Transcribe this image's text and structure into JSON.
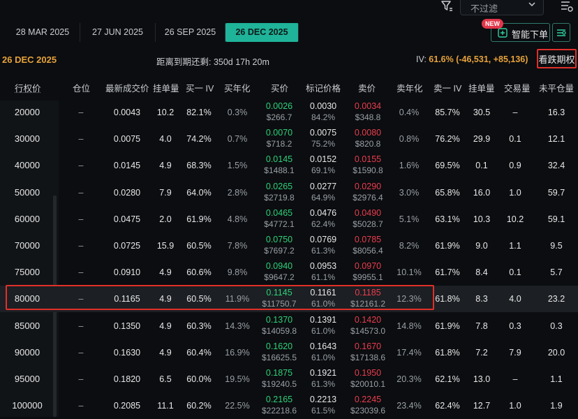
{
  "toolbar": {
    "filter_value": "不过滤",
    "filter_icon": "funnel-icon",
    "settings_icon": "list-settings-icon"
  },
  "tabs": [
    {
      "label": "28 MAR 2025",
      "active": false
    },
    {
      "label": "27 JUN 2025",
      "active": false
    },
    {
      "label": "26 SEP 2025",
      "active": false
    },
    {
      "label": "26 DEC 2025",
      "active": true
    }
  ],
  "smart_order": {
    "label": "智能下单",
    "badge": "NEW"
  },
  "info": {
    "date": "26 DEC 2025",
    "expiry": "距离到期还剩: 350d 17h 20m",
    "iv_label": "IV: ",
    "iv_value": "61.6% (-46,531, +85,136)",
    "put_label": "看跌期权"
  },
  "headers": [
    "行权价",
    "仓位",
    "最新成交价",
    "挂单量",
    "买一 IV",
    "买年化",
    "买价",
    "标记价格",
    "卖价",
    "卖年化",
    "卖一 IV",
    "挂单量",
    "交易量",
    "未平仓量"
  ],
  "rows": [
    {
      "strike": "20000",
      "pos": "–",
      "last": "0.0043",
      "bid_size": "10.2",
      "bid_iv": "82.1%",
      "bid_ann": "0.3%",
      "bid": "0.0026",
      "bid_usd": "$266.7",
      "mark": "0.0030",
      "mark_iv": "84.2%",
      "ask": "0.0034",
      "ask_usd": "$348.8",
      "ask_ann": "0.4%",
      "ask_iv": "85.7%",
      "ask_size": "30.5",
      "volume": "–",
      "oi": "16.3"
    },
    {
      "strike": "30000",
      "pos": "–",
      "last": "0.0075",
      "bid_size": "4.0",
      "bid_iv": "74.2%",
      "bid_ann": "0.7%",
      "bid": "0.0070",
      "bid_usd": "$718.2",
      "mark": "0.0075",
      "mark_iv": "75.2%",
      "ask": "0.0080",
      "ask_usd": "$820.8",
      "ask_ann": "0.8%",
      "ask_iv": "76.2%",
      "ask_size": "29.9",
      "volume": "0.1",
      "oi": "12.1"
    },
    {
      "strike": "40000",
      "pos": "–",
      "last": "0.0145",
      "bid_size": "4.9",
      "bid_iv": "68.3%",
      "bid_ann": "1.5%",
      "bid": "0.0145",
      "bid_usd": "$1488.1",
      "mark": "0.0152",
      "mark_iv": "69.1%",
      "ask": "0.0155",
      "ask_usd": "$1590.8",
      "ask_ann": "1.6%",
      "ask_iv": "69.5%",
      "ask_size": "0.1",
      "volume": "0.9",
      "oi": "32.4"
    },
    {
      "strike": "50000",
      "pos": "–",
      "last": "0.0280",
      "bid_size": "7.9",
      "bid_iv": "64.0%",
      "bid_ann": "2.8%",
      "bid": "0.0265",
      "bid_usd": "$2719.8",
      "mark": "0.0277",
      "mark_iv": "64.9%",
      "ask": "0.0290",
      "ask_usd": "$2976.4",
      "ask_ann": "3.0%",
      "ask_iv": "65.8%",
      "ask_size": "16.0",
      "volume": "1.0",
      "oi": "59.7"
    },
    {
      "strike": "60000",
      "pos": "–",
      "last": "0.0475",
      "bid_size": "2.0",
      "bid_iv": "61.9%",
      "bid_ann": "4.8%",
      "bid": "0.0465",
      "bid_usd": "$4772.1",
      "mark": "0.0476",
      "mark_iv": "62.4%",
      "ask": "0.0490",
      "ask_usd": "$5028.7",
      "ask_ann": "5.1%",
      "ask_iv": "63.1%",
      "ask_size": "10.3",
      "volume": "10.2",
      "oi": "59.1"
    },
    {
      "strike": "70000",
      "pos": "–",
      "last": "0.0725",
      "bid_size": "15.9",
      "bid_iv": "60.5%",
      "bid_ann": "7.8%",
      "bid": "0.0750",
      "bid_usd": "$7697.2",
      "mark": "0.0769",
      "mark_iv": "61.3%",
      "ask": "0.0785",
      "ask_usd": "$8056.4",
      "ask_ann": "8.2%",
      "ask_iv": "61.9%",
      "ask_size": "9.0",
      "volume": "1.1",
      "oi": "9.5"
    },
    {
      "strike": "75000",
      "pos": "–",
      "last": "0.0910",
      "bid_size": "4.9",
      "bid_iv": "60.6%",
      "bid_ann": "9.8%",
      "bid": "0.0940",
      "bid_usd": "$9647.2",
      "mark": "0.0953",
      "mark_iv": "61.1%",
      "ask": "0.0970",
      "ask_usd": "$9955.1",
      "ask_ann": "10.1%",
      "ask_iv": "61.7%",
      "ask_size": "8.4",
      "volume": "0.1",
      "oi": "5.7"
    },
    {
      "strike": "80000",
      "pos": "–",
      "last": "0.1165",
      "bid_size": "4.9",
      "bid_iv": "60.5%",
      "bid_ann": "11.9%",
      "bid": "0.1145",
      "bid_usd": "$11750.7",
      "mark": "0.1161",
      "mark_iv": "61.0%",
      "ask": "0.1185",
      "ask_usd": "$12161.2",
      "ask_ann": "12.3%",
      "ask_iv": "61.8%",
      "ask_size": "8.3",
      "volume": "4.0",
      "oi": "23.2"
    },
    {
      "strike": "85000",
      "pos": "–",
      "last": "0.1350",
      "bid_size": "4.9",
      "bid_iv": "60.3%",
      "bid_ann": "14.3%",
      "bid": "0.1370",
      "bid_usd": "$14059.8",
      "mark": "0.1391",
      "mark_iv": "61.0%",
      "ask": "0.1420",
      "ask_usd": "$14573.0",
      "ask_ann": "14.8%",
      "ask_iv": "61.9%",
      "ask_size": "7.8",
      "volume": "0.3",
      "oi": "0.3"
    },
    {
      "strike": "90000",
      "pos": "–",
      "last": "0.1630",
      "bid_size": "4.9",
      "bid_iv": "60.4%",
      "bid_ann": "16.9%",
      "bid": "0.1620",
      "bid_usd": "$16625.5",
      "mark": "0.1643",
      "mark_iv": "61.0%",
      "ask": "0.1670",
      "ask_usd": "$17138.6",
      "ask_ann": "17.4%",
      "ask_iv": "61.8%",
      "ask_size": "7.2",
      "volume": "7.9",
      "oi": "20.0"
    },
    {
      "strike": "95000",
      "pos": "–",
      "last": "0.1820",
      "bid_size": "6.5",
      "bid_iv": "60.0%",
      "bid_ann": "19.5%",
      "bid": "0.1875",
      "bid_usd": "$19240.5",
      "mark": "0.1921",
      "mark_iv": "61.3%",
      "ask": "0.1950",
      "ask_usd": "$20010.1",
      "ask_ann": "20.3%",
      "ask_iv": "62.1%",
      "ask_size": "13.0",
      "volume": "–",
      "oi": "1.1"
    },
    {
      "strike": "100000",
      "pos": "–",
      "last": "0.2085",
      "bid_size": "11.1",
      "bid_iv": "60.2%",
      "bid_ann": "22.5%",
      "bid": "0.2165",
      "bid_usd": "$22218.6",
      "mark": "0.2213",
      "mark_iv": "61.5%",
      "ask": "0.2245",
      "ask_usd": "$23039.6",
      "ask_ann": "23.4%",
      "ask_iv": "62.4%",
      "ask_size": "12.7",
      "volume": "1.0",
      "oi": "1.9"
    }
  ],
  "colors": {
    "accent": "#1fb39a",
    "bid": "#2ed17a",
    "ask": "#ea3d4e",
    "highlight": "#e0302a",
    "orange": "#e8a23a"
  }
}
